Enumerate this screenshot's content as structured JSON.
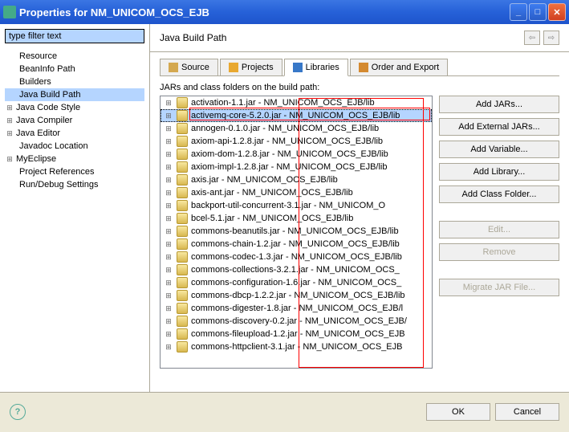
{
  "window": {
    "title": "Properties for NM_UNICOM_OCS_EJB"
  },
  "filter": {
    "placeholder": "type filter text"
  },
  "tree": {
    "items": [
      {
        "label": "Resource",
        "expandable": false,
        "indent": 1
      },
      {
        "label": "BeanInfo Path",
        "expandable": false,
        "indent": 1
      },
      {
        "label": "Builders",
        "expandable": false,
        "indent": 1
      },
      {
        "label": "Java Build Path",
        "expandable": false,
        "indent": 1,
        "selected": true
      },
      {
        "label": "Java Code Style",
        "expandable": true,
        "indent": 0
      },
      {
        "label": "Java Compiler",
        "expandable": true,
        "indent": 0
      },
      {
        "label": "Java Editor",
        "expandable": true,
        "indent": 0
      },
      {
        "label": "Javadoc Location",
        "expandable": false,
        "indent": 1
      },
      {
        "label": "MyEclipse",
        "expandable": true,
        "indent": 0
      },
      {
        "label": "Project References",
        "expandable": false,
        "indent": 1
      },
      {
        "label": "Run/Debug Settings",
        "expandable": false,
        "indent": 1
      }
    ]
  },
  "header": {
    "title": "Java Build Path"
  },
  "tabs": {
    "source": "Source",
    "projects": "Projects",
    "libraries": "Libraries",
    "order": "Order and Export"
  },
  "list": {
    "label": "JARs and class folders on the build path:",
    "items": [
      "activation-1.1.jar - NM_UNICOM_OCS_EJB/lib",
      "activemq-core-5.2.0.jar - NM_UNICOM_OCS_EJB/lib",
      "annogen-0.1.0.jar - NM_UNICOM_OCS_EJB/lib",
      "axiom-api-1.2.8.jar - NM_UNICOM_OCS_EJB/lib",
      "axiom-dom-1.2.8.jar - NM_UNICOM_OCS_EJB/lib",
      "axiom-impl-1.2.8.jar - NM_UNICOM_OCS_EJB/lib",
      "axis.jar - NM_UNICOM_OCS_EJB/lib",
      "axis-ant.jar - NM_UNICOM_OCS_EJB/lib",
      "backport-util-concurrent-3.1.jar - NM_UNICOM_O",
      "bcel-5.1.jar - NM_UNICOM_OCS_EJB/lib",
      "commons-beanutils.jar - NM_UNICOM_OCS_EJB/lib",
      "commons-chain-1.2.jar - NM_UNICOM_OCS_EJB/lib",
      "commons-codec-1.3.jar - NM_UNICOM_OCS_EJB/lib",
      "commons-collections-3.2.1.jar - NM_UNICOM_OCS_",
      "commons-configuration-1.6.jar - NM_UNICOM_OCS_",
      "commons-dbcp-1.2.2.jar - NM_UNICOM_OCS_EJB/lib",
      "commons-digester-1.8.jar - NM_UNICOM_OCS_EJB/l",
      "commons-discovery-0.2.jar - NM_UNICOM_OCS_EJB/",
      "commons-fileupload-1.2.jar - NM_UNICOM_OCS_EJB",
      "commons-httpclient-3.1.jar - NM_UNICOM_OCS_EJB"
    ],
    "selected_index": 1
  },
  "buttons": {
    "add_jars": "Add JARs...",
    "add_external": "Add External JARs...",
    "add_variable": "Add Variable...",
    "add_library": "Add Library...",
    "add_class_folder": "Add Class Folder...",
    "edit": "Edit...",
    "remove": "Remove",
    "migrate": "Migrate JAR File..."
  },
  "bottom": {
    "ok": "OK",
    "cancel": "Cancel"
  }
}
